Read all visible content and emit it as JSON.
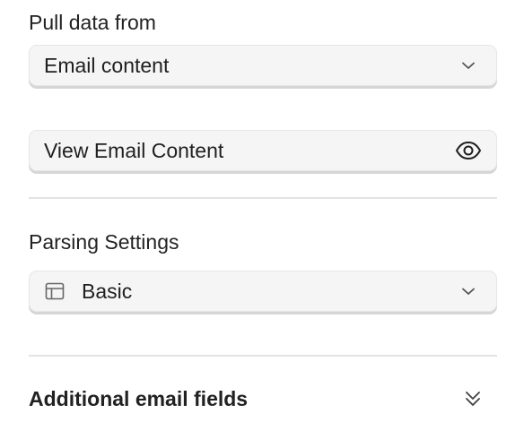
{
  "pull_data": {
    "label": "Pull data from",
    "selected": "Email content",
    "chevron_icon": "chevron-down-icon"
  },
  "view_content": {
    "label": "View Email Content",
    "icon": "eye-icon"
  },
  "parsing": {
    "title": "Parsing Settings",
    "selected": "Basic",
    "leading_icon": "layout-icon",
    "chevron_icon": "chevron-down-icon"
  },
  "additional": {
    "title": "Additional email fields",
    "icon": "double-chevron-down-icon"
  },
  "colors": {
    "field_bg": "#f5f5f5",
    "field_border": "#e6e6e6",
    "divider": "#e3e3e3",
    "text": "#222222",
    "icon": "#555555"
  }
}
